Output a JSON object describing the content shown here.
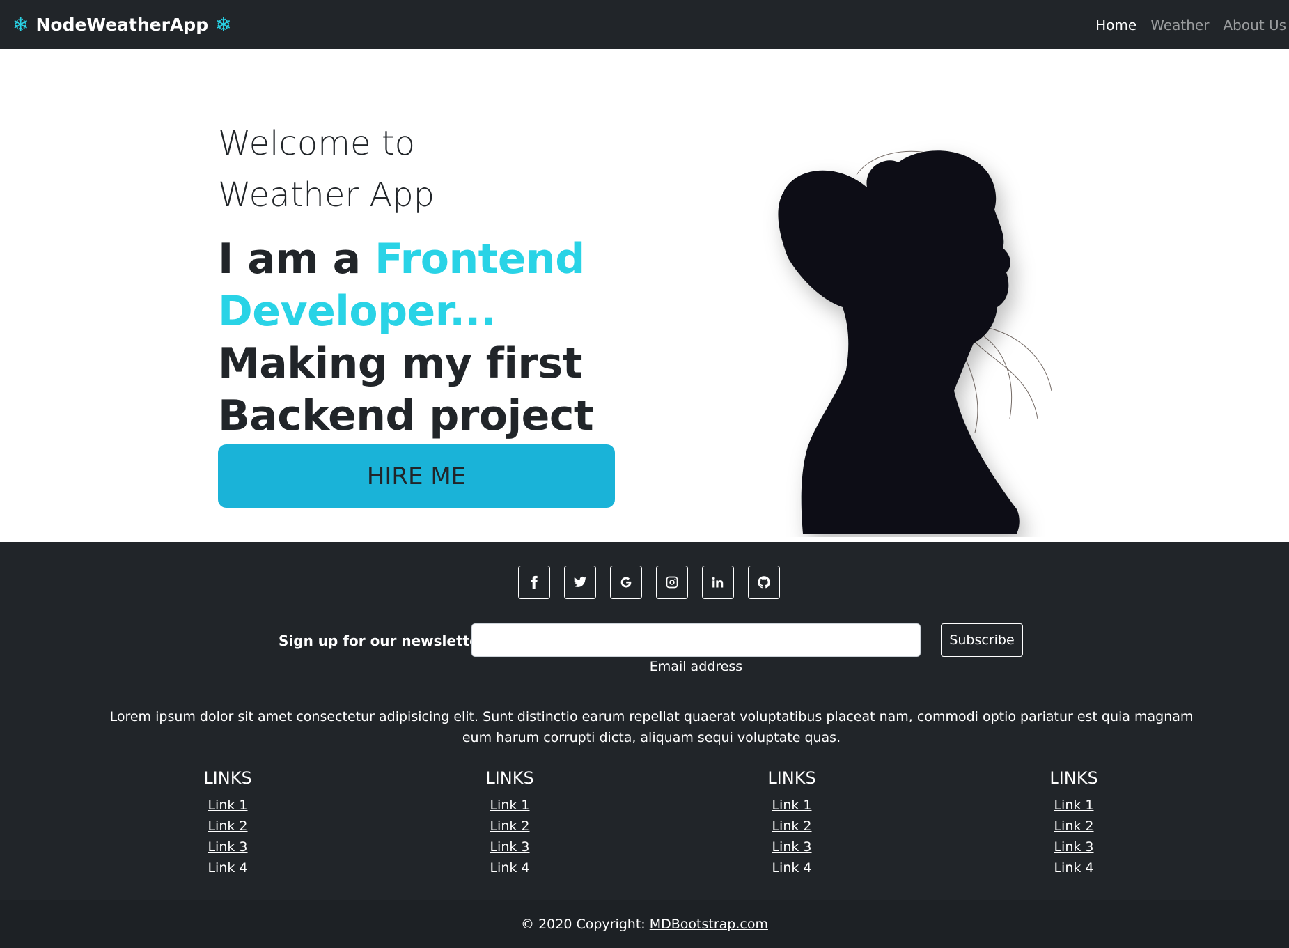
{
  "navbar": {
    "brand": "NodeWeatherApp",
    "brand_icon": "snowflake-icon",
    "brand_icon_color": "#29d3e6",
    "links": [
      {
        "label": "Home",
        "active": true
      },
      {
        "label": "Weather",
        "active": false
      },
      {
        "label": "About Us",
        "active": false
      }
    ]
  },
  "hero": {
    "welcome_line1": "Welcome to",
    "welcome_line2": "Weather App",
    "headline_prefix": "I am a ",
    "headline_accent": "Frontend Developer...",
    "headline_suffix": "Making my first Backend project",
    "accent_color": "#29d3e6",
    "cta_label": "HIRE ME",
    "cta_color": "#1ab3d8"
  },
  "footer": {
    "socials": [
      "facebook-icon",
      "twitter-icon",
      "google-icon",
      "instagram-icon",
      "linkedin-icon",
      "github-icon"
    ],
    "newsletter_label": "Sign up for our newsletter",
    "email_value": "",
    "email_label": "Email address",
    "subscribe_label": "Subscribe",
    "lorem": "Lorem ipsum dolor sit amet consectetur adipisicing elit. Sunt distinctio earum repellat quaerat voluptatibus placeat nam, commodi optio pariatur est quia magnam eum harum corrupti dicta, aliquam sequi voluptate quas.",
    "link_columns": [
      {
        "title": "LINKS",
        "links": [
          "Link 1",
          "Link 2",
          "Link 3",
          "Link 4"
        ]
      },
      {
        "title": "LINKS",
        "links": [
          "Link 1",
          "Link 2",
          "Link 3",
          "Link 4"
        ]
      },
      {
        "title": "LINKS",
        "links": [
          "Link 1",
          "Link 2",
          "Link 3",
          "Link 4"
        ]
      },
      {
        "title": "LINKS",
        "links": [
          "Link 1",
          "Link 2",
          "Link 3",
          "Link 4"
        ]
      }
    ],
    "copyright_text": "© 2020 Copyright:",
    "copyright_link": "MDBootstrap.com"
  }
}
